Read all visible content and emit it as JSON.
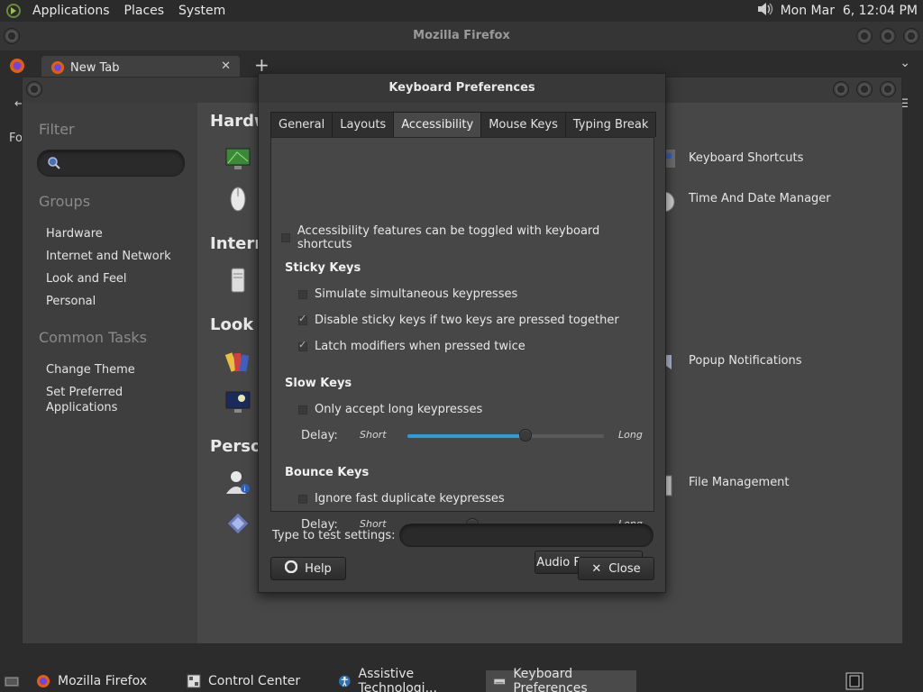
{
  "top_panel": {
    "menus": [
      "Applications",
      "Places",
      "System"
    ],
    "clock": "Mon Mar  6, 12:04 PM"
  },
  "firefox": {
    "window_title": "Mozilla Firefox",
    "tab_title": "New Tab",
    "nav_partial_text": "Fo"
  },
  "control_center": {
    "sidebar": {
      "filter_heading": "Filter",
      "groups_heading": "Groups",
      "groups": [
        "Hardware",
        "Internet and Network",
        "Look and Feel",
        "Personal"
      ],
      "tasks_heading": "Common Tasks",
      "task_change_theme": "Change Theme",
      "task_preferred_line1": "Set Preferred",
      "task_preferred_line2": "Applications"
    },
    "categories": [
      "Hardw",
      "Intern",
      "Look a",
      "Perso"
    ],
    "right_items": [
      "Keyboard Shortcuts",
      "Time And Date Manager",
      "Popup Notifications",
      "File Management"
    ]
  },
  "keyboard_prefs": {
    "title": "Keyboard Preferences",
    "tabs": [
      "General",
      "Layouts",
      "Accessibility",
      "Mouse Keys",
      "Typing Break"
    ],
    "active_tab": "Accessibility",
    "toggle_label": "Accessibility features can be toggled with keyboard shortcuts",
    "sticky": {
      "title": "Sticky Keys",
      "simulate": "Simulate simultaneous keypresses",
      "disable": "Disable sticky keys if two keys are pressed together",
      "latch": "Latch modifiers when pressed twice"
    },
    "slow": {
      "title": "Slow Keys",
      "only_long": "Only accept long keypresses",
      "delay_label": "Delay:",
      "short": "Short",
      "long": "Long",
      "level": 0.6
    },
    "bounce": {
      "title": "Bounce Keys",
      "ignore": "Ignore fast duplicate keypresses",
      "delay_label": "Delay:",
      "short": "Short",
      "long": "Long",
      "level": 0.33
    },
    "audio_feedback": "Audio Feedback...",
    "test_label": "Type to test settings:",
    "test_value": "",
    "help": "Help",
    "close": "Close"
  },
  "taskbar": {
    "items": [
      "Mozilla Firefox",
      "Control Center",
      "Assistive Technologi...",
      "Keyboard Preferences"
    ],
    "active": "Keyboard Preferences"
  },
  "colors": {
    "accent": "#2e9bd3"
  }
}
